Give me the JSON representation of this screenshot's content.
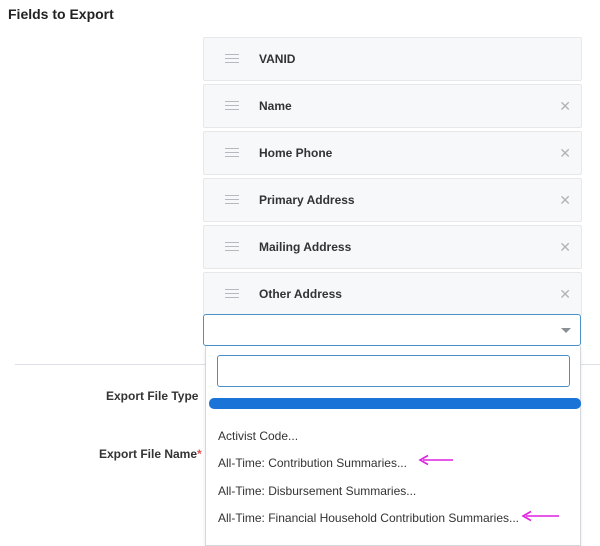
{
  "section": {
    "title": "Fields to Export"
  },
  "fields": [
    {
      "label": "VANID",
      "removable": false
    },
    {
      "label": "Name",
      "removable": true
    },
    {
      "label": "Home Phone",
      "removable": true
    },
    {
      "label": "Primary Address",
      "removable": true
    },
    {
      "label": "Mailing Address",
      "removable": true
    },
    {
      "label": "Other Address",
      "removable": true
    }
  ],
  "remove_glyph": "✕",
  "add_field_select": {
    "value": ""
  },
  "form": {
    "export_file_type_label": "Export File Type",
    "export_file_name_label": "Export File Name",
    "required_mark": "*"
  },
  "dropdown": {
    "search_value": "",
    "highlight_color": "#1a73d6",
    "options": [
      {
        "label": "Activist Code...",
        "annotated": false
      },
      {
        "label": "All-Time: Contribution Summaries...",
        "annotated": true
      },
      {
        "label": "All-Time: Disbursement Summaries...",
        "annotated": false
      },
      {
        "label": "All-Time: Financial Household Contribution Summaries...",
        "annotated": true
      }
    ]
  },
  "colors": {
    "accent_border": "#4a90c8",
    "annotation_arrow": "#e020e0",
    "required": "#d9534f"
  }
}
